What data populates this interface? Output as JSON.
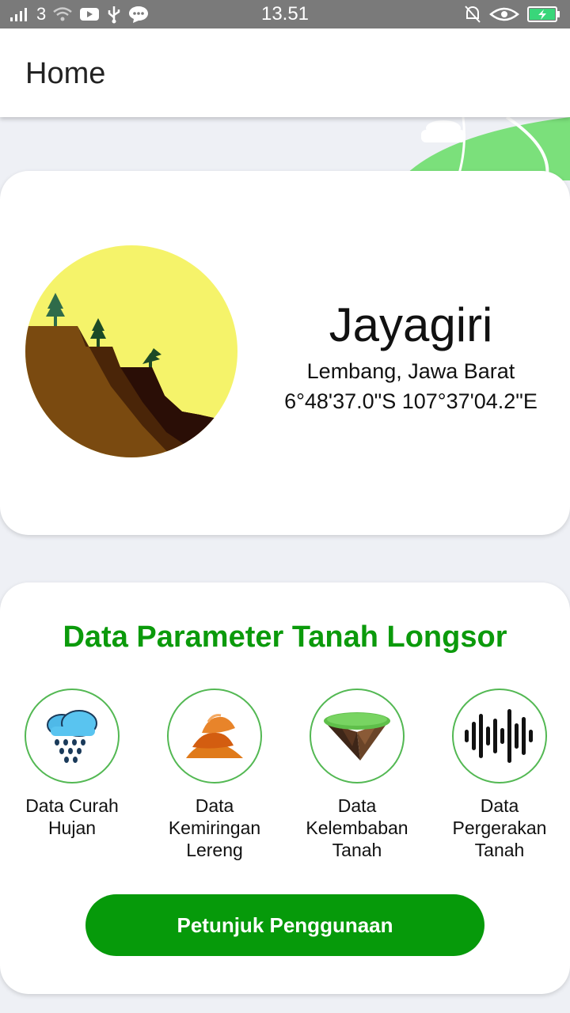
{
  "status_bar": {
    "network": "3",
    "time": "13.51",
    "icons_left": [
      "signal-icon",
      "wifi-icon",
      "youtube-icon",
      "usb-icon",
      "message-icon"
    ],
    "icons_right": [
      "mute-icon",
      "eye-icon",
      "battery-charging-icon"
    ]
  },
  "app_bar": {
    "title": "Home"
  },
  "location": {
    "name": "Jayagiri",
    "region": "Lembang, Jawa Barat",
    "coordinates": "6°48'37.0\"S 107°37'04.2\"E",
    "illustration": "landslide-illustration"
  },
  "parameters": {
    "title": "Data Parameter Tanah Longsor",
    "items": [
      {
        "label_lines": [
          "Data Curah",
          "Hujan"
        ],
        "icon": "rain-cloud-icon"
      },
      {
        "label_lines": [
          "Data",
          "Kemiringan",
          "Lereng"
        ],
        "icon": "slope-icon"
      },
      {
        "label_lines": [
          "Data",
          "Kelembaban",
          "Tanah"
        ],
        "icon": "soil-icon"
      },
      {
        "label_lines": [
          "Data",
          "Pergerakan",
          "Tanah"
        ],
        "icon": "sound-wave-icon"
      }
    ],
    "guide_button": "Petunjuk Penggunaan"
  },
  "colors": {
    "accent_green": "#0b9a0b",
    "button_green": "#069a0a",
    "status_bar": "#7a7a7a",
    "background": "#eef0f5"
  }
}
